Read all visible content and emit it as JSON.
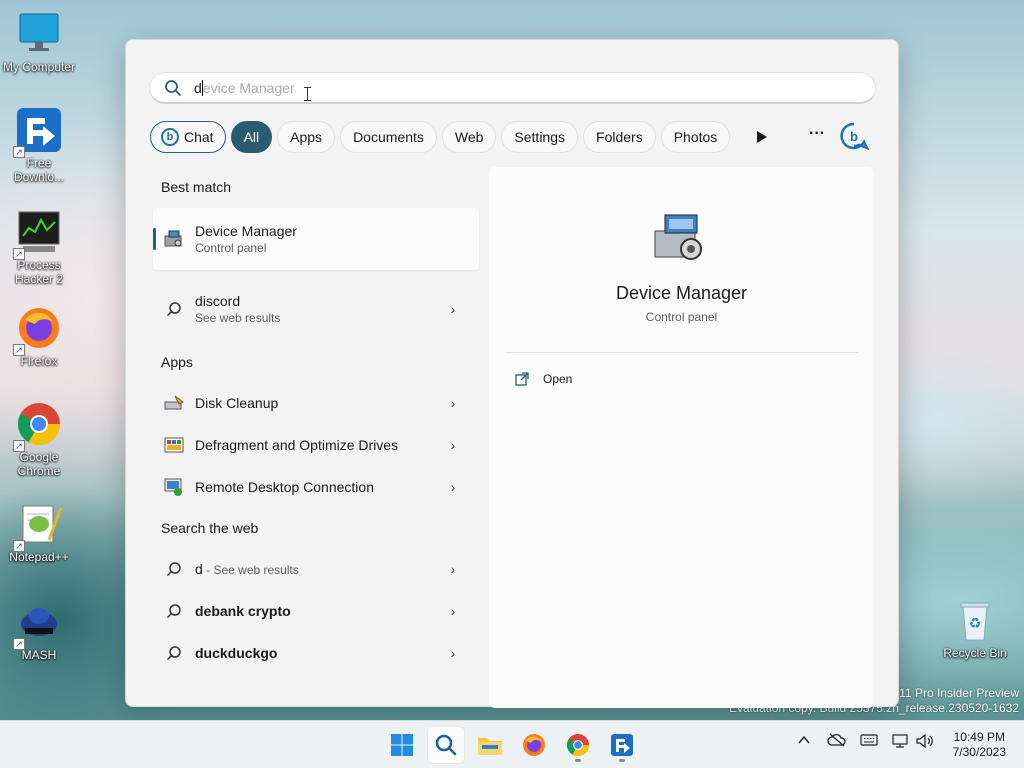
{
  "desktop": {
    "icons": [
      {
        "label": "My Computer"
      },
      {
        "label": "Free Downlo..."
      },
      {
        "label": "Process Hacker 2"
      },
      {
        "label": "Firefox"
      },
      {
        "label": "Google Chrome"
      },
      {
        "label": "Notepad++"
      },
      {
        "label": "MASH"
      },
      {
        "label": "Recycle Bin"
      }
    ],
    "watermark_line1": "s 11 Pro Insider Preview",
    "watermark_line2": "Evaluation copy. Build 25375.zn_release.230520-1632"
  },
  "search": {
    "typed": "d",
    "suggestion_remainder": "evice Manager"
  },
  "filters": [
    "Chat",
    "All",
    "Apps",
    "Documents",
    "Web",
    "Settings",
    "Folders",
    "Photos"
  ],
  "more_label": "···",
  "best_match": {
    "heading": "Best match",
    "title": "Device Manager",
    "subtitle": "Control panel"
  },
  "web_top": {
    "title": "discord",
    "subtitle": "See web results"
  },
  "apps": {
    "heading": "Apps",
    "items": [
      {
        "pre": "D",
        "rest": "isk Cleanup"
      },
      {
        "pre": "D",
        "rest": "efragment and Optimize Drives"
      },
      {
        "pre": "",
        "rest": "Remote Desktop Connection"
      }
    ]
  },
  "web": {
    "heading": "Search the web",
    "items": [
      {
        "bold": "d",
        "dim": " - See web results"
      },
      {
        "bold": "debank crypto",
        "dim": ""
      },
      {
        "bold": "duckduckgo",
        "dim": ""
      }
    ]
  },
  "preview": {
    "title": "Device Manager",
    "subtitle": "Control panel",
    "action_open": "Open"
  },
  "taskbar": {
    "time": "10:49 PM",
    "date": "7/30/2023"
  }
}
